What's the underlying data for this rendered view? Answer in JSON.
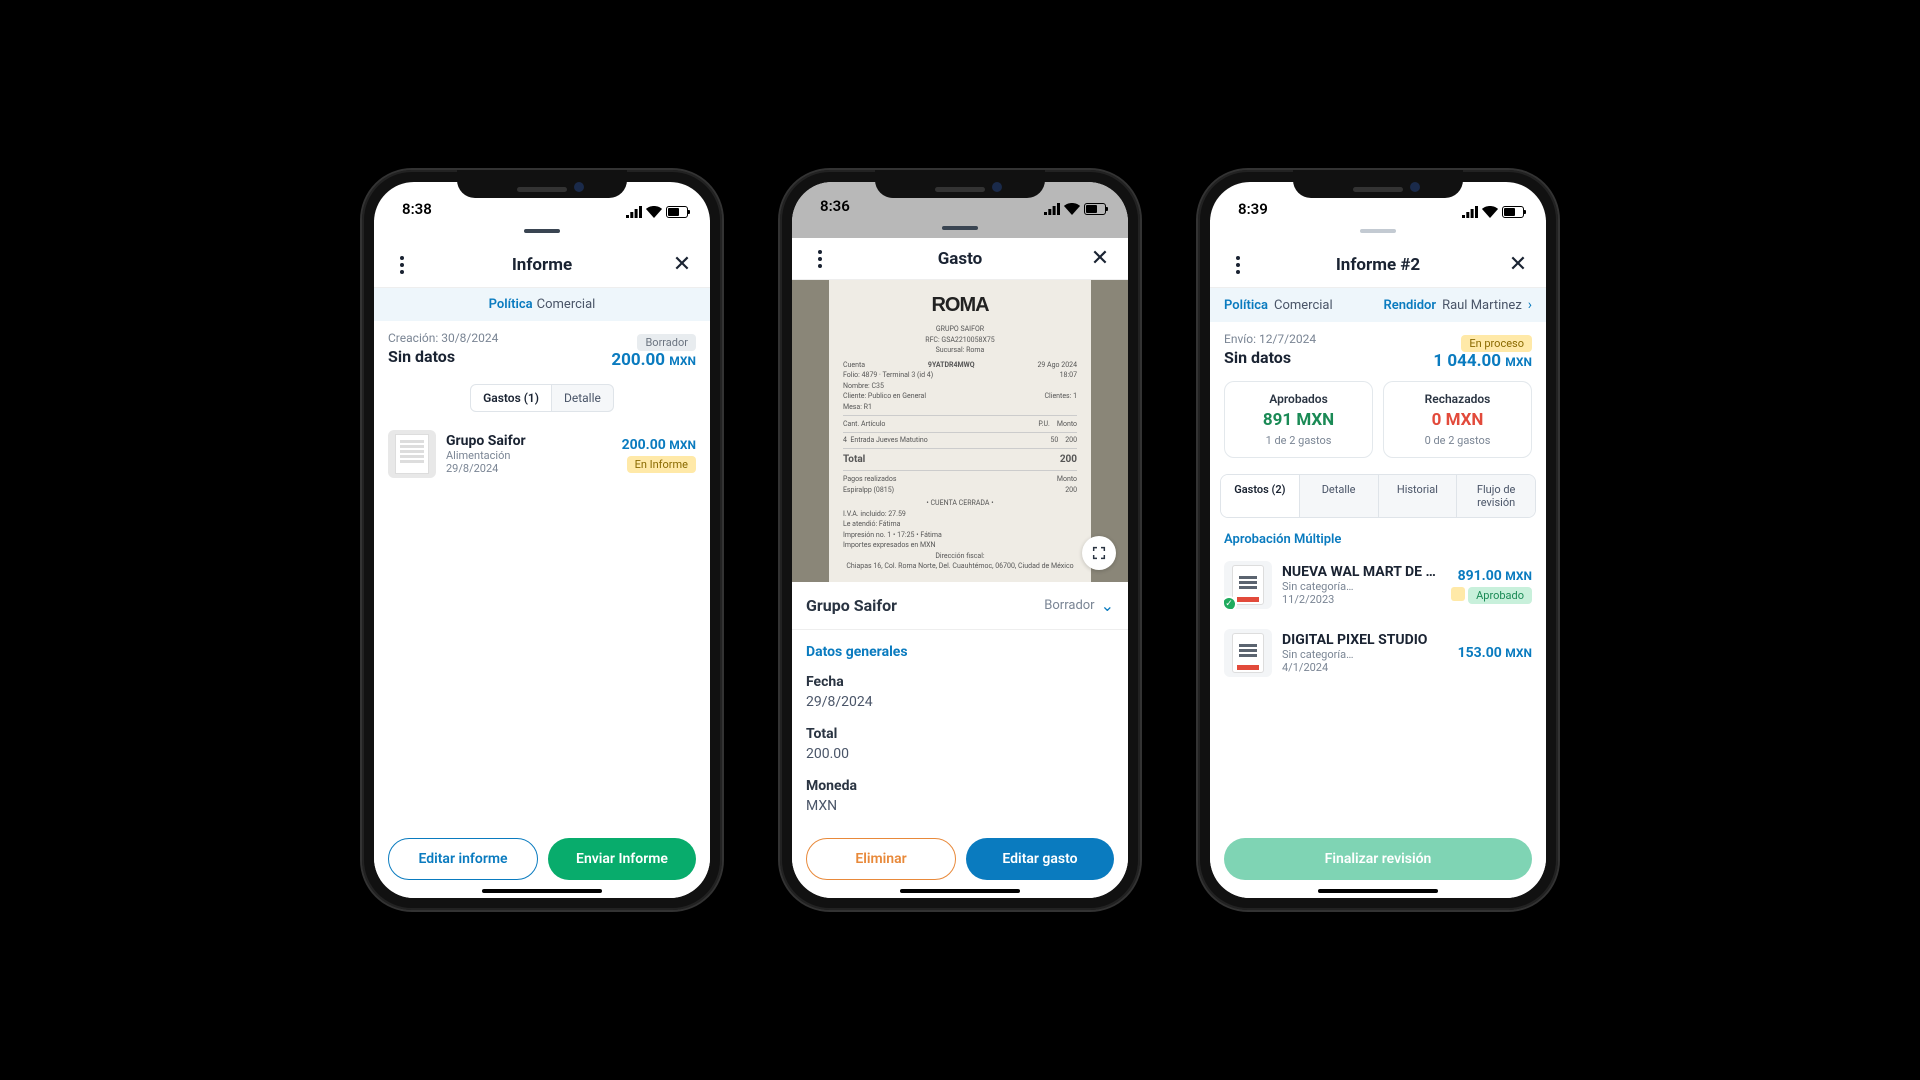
{
  "phone1": {
    "time": "8:38",
    "header_title": "Informe",
    "policy_label": "Política",
    "policy_value": "Comercial",
    "creation_label": "Creación:",
    "creation_date": "30/8/2024",
    "status_badge": "Borrador",
    "subtitle": "Sin datos",
    "amount": "200.00",
    "currency": "MXN",
    "tabs": {
      "gastos": "Gastos (1)",
      "detalle": "Detalle"
    },
    "expense": {
      "name": "Grupo Saifor",
      "category": "Alimentación",
      "date": "29/8/2024",
      "amount": "200.00",
      "currency": "MXN",
      "badge": "En Informe"
    },
    "btn_edit": "Editar informe",
    "btn_send": "Enviar Informe"
  },
  "phone2": {
    "time": "8:36",
    "header_title": "Gasto",
    "receipt": {
      "logo_line": "ROMA",
      "company": "GRUPO SAIFOR",
      "rfc": "RFC: GSA2210058X75",
      "branch": "Sucursal: Roma",
      "code": "9YATDR4MWQ",
      "date": "29 Ago 2024",
      "folio": "Folio: 4879 · Terminal 3 (id 4)",
      "nombre": "Nombre: C35",
      "cliente": "Cliente: Publico en General",
      "mesa": "Mesa: R1",
      "clientes": "Clientes: 1",
      "item_qty": "4",
      "item_name": "Entrada Jueves Matutino",
      "item_pu": "50",
      "item_monto": "200",
      "total_label": "Total",
      "total": "200",
      "pago": "Espiralpp (0815)",
      "pago_monto": "200",
      "closed": "• CUENTA CERRADA •",
      "iva": "I.V.A. incluido: 27.59",
      "atendio": "Le atendió: Fátima",
      "impresion": "Impresión no. 1 • 17:25 • Fátima",
      "moneda_note": "Importes expresados en MXN",
      "fiscal_title": "Dirección fiscal:",
      "fiscal": "Chiapas 16, Col. Roma Norte, Del. Cuauhtémoc, 06700, Ciudad de México"
    },
    "vendor": "Grupo Saifor",
    "status": "Borrador",
    "section_general": "Datos generales",
    "fields": {
      "fecha_label": "Fecha",
      "fecha": "29/8/2024",
      "total_label": "Total",
      "total": "200.00",
      "moneda_label": "Moneda",
      "moneda": "MXN"
    },
    "btn_delete": "Eliminar",
    "btn_edit": "Editar gasto"
  },
  "phone3": {
    "time": "8:39",
    "header_title": "Informe #2",
    "policy_label": "Política",
    "policy_value": "Comercial",
    "renderer_label": "Rendidor",
    "renderer_value": "Raul Martinez",
    "send_label": "Envío:",
    "send_date": "12/7/2024",
    "status_badge": "En proceso",
    "subtitle": "Sin datos",
    "amount": "1 044.00",
    "currency": "MXN",
    "stats": {
      "approved_label": "Aprobados",
      "approved_value": "891 MXN",
      "approved_sub": "1 de 2 gastos",
      "rejected_label": "Rechazados",
      "rejected_value": "0 MXN",
      "rejected_sub": "0 de 2 gastos"
    },
    "tabs": {
      "gastos": "Gastos (2)",
      "detalle": "Detalle",
      "historial": "Historial",
      "flujo": "Flujo de revisión"
    },
    "approve_title": "Aprobación Múltiple",
    "expenses": [
      {
        "name": "NUEVA WAL MART DE …",
        "category": "Sin categoría…",
        "date": "11/2/2023",
        "amount": "891.00",
        "currency": "MXN",
        "badge": "Aprobado"
      },
      {
        "name": "DIGITAL PIXEL STUDIO",
        "category": "Sin categoría…",
        "date": "4/1/2024",
        "amount": "153.00",
        "currency": "MXN"
      }
    ],
    "btn_finalize": "Finalizar revisión"
  }
}
